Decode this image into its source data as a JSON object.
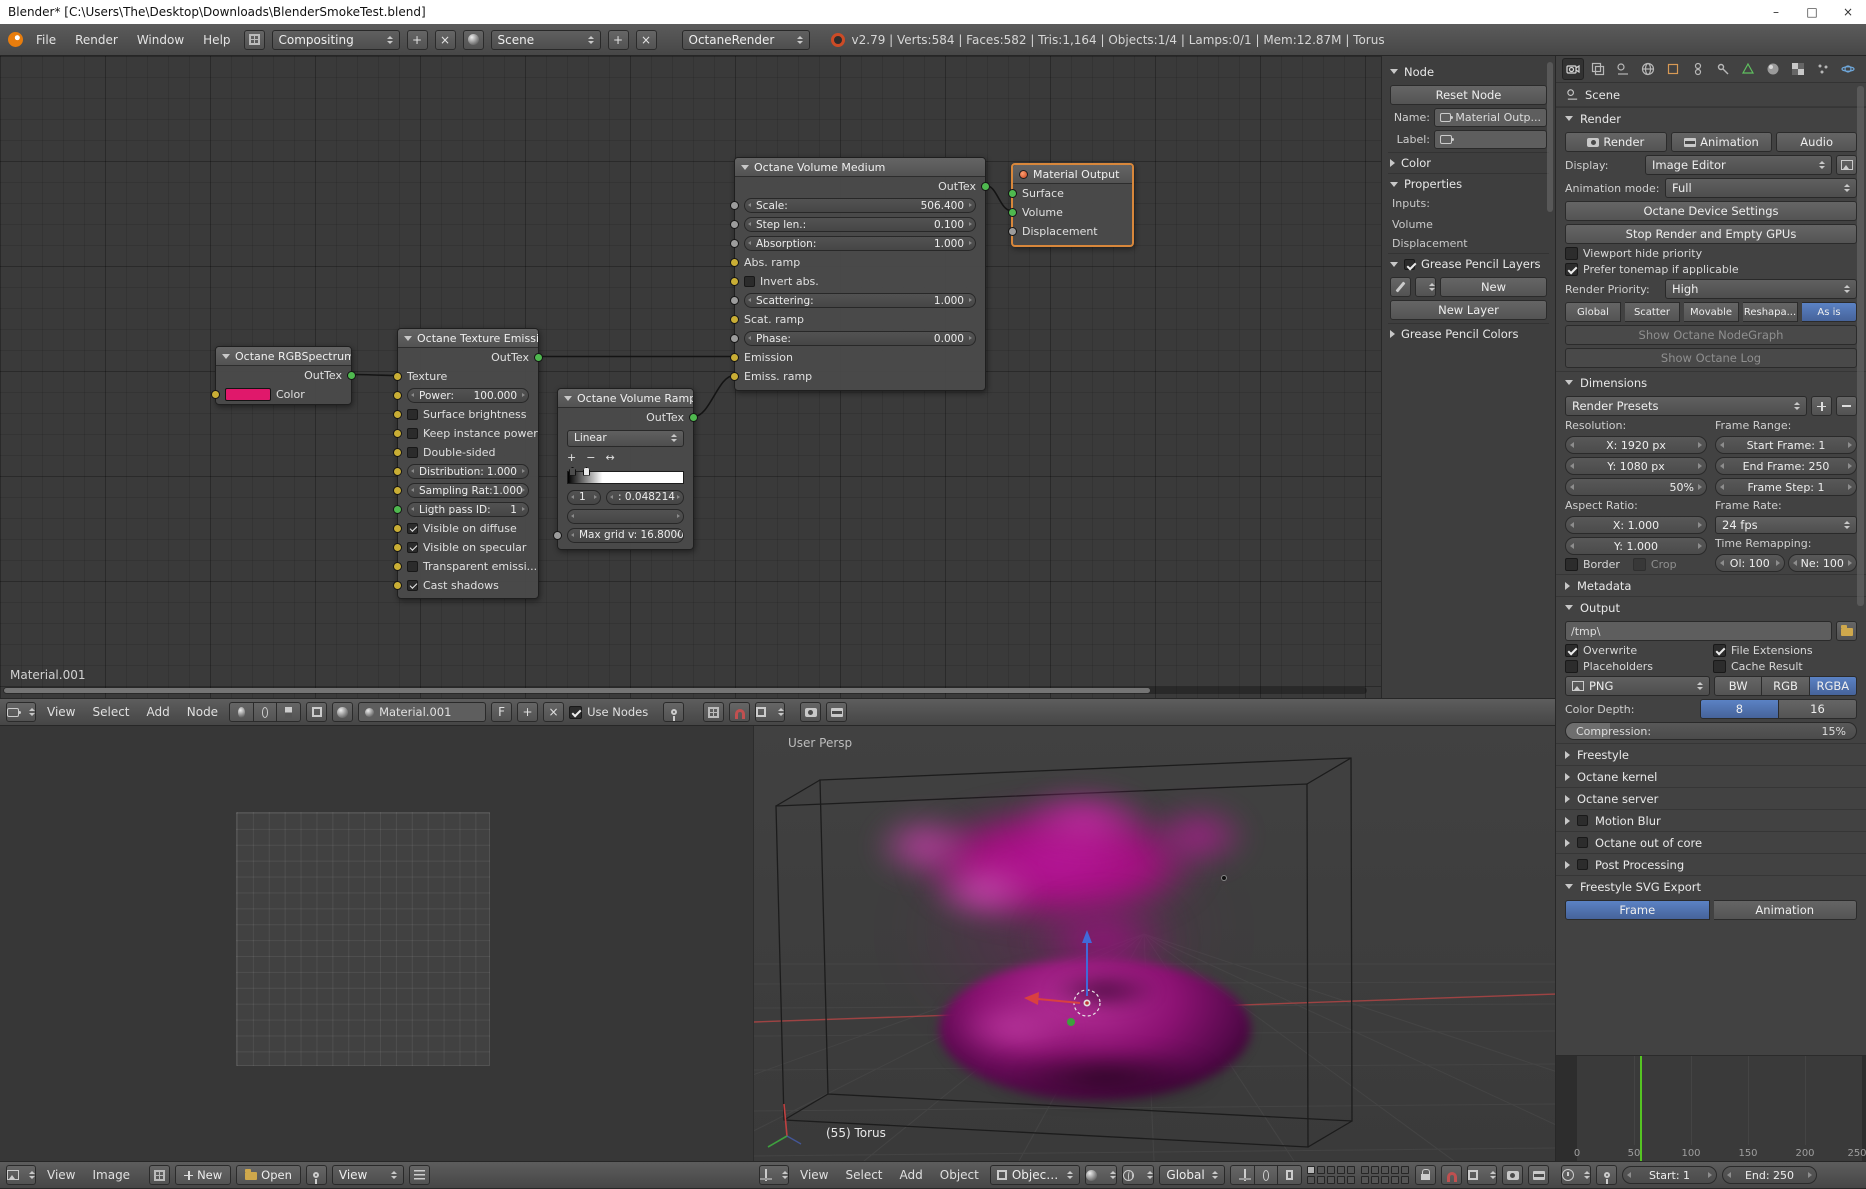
{
  "titlebar": {
    "title": "Blender* [C:\\Users\\The\\Desktop\\Downloads\\BlenderSmokeTest.blend]",
    "minimize": "–",
    "maximize": "□",
    "close": "×"
  },
  "topbar": {
    "menus": [
      "File",
      "Render",
      "Window",
      "Help"
    ],
    "layout": "Compositing",
    "layout_add": "+",
    "layout_close": "×",
    "scene": "Scene",
    "scene_add": "+",
    "scene_close": "×",
    "engine": "OctaneRender",
    "stats": "v2.79 | Verts:584 | Faces:582 | Tris:1,164 | Objects:1/4 | Lamps:0/1 | Mem:12.87M | Torus"
  },
  "node_editor": {
    "material_label": "Material.001"
  },
  "nodes": {
    "rgb": {
      "title": "Octane RGBSpectrum ...",
      "out": "OutTex",
      "color": "Color",
      "swatch": "#e0186b"
    },
    "emission": {
      "title": "Octane Texture Emissi...",
      "out": "OutTex",
      "texture": "Texture",
      "rows": [
        {
          "label": "Power:",
          "value": "100.000"
        },
        {
          "label": "Surface brightness",
          "checked": false
        },
        {
          "label": "Keep instance power",
          "checked": false
        },
        {
          "label": "Double-sided",
          "checked": false
        },
        {
          "label": "Distribution:",
          "value": "1.000"
        },
        {
          "label": "Sampling Rat:",
          "value": "1.000"
        },
        {
          "label": "Ligth pass ID:",
          "value": "1"
        },
        {
          "label": "Visible on diffuse",
          "checked": true
        },
        {
          "label": "Visible on specular",
          "checked": true
        },
        {
          "label": "Transparent emissi...",
          "checked": false
        },
        {
          "label": "Cast shadows",
          "checked": true
        }
      ]
    },
    "ramp": {
      "title": "Octane Volume Ramp ...",
      "out": "OutTex",
      "interpolation": "Linear",
      "add": "+",
      "remove": "−",
      "flip": "↔",
      "index": "1",
      "position": ": 0.048214",
      "max_grid": "Max grid v: 16.8000"
    },
    "medium": {
      "title": "Octane Volume Medium",
      "out": "OutTex",
      "rows": [
        {
          "label": "Scale:",
          "value": "506.400"
        },
        {
          "label": "Step len.:",
          "value": "0.100"
        },
        {
          "label": "Absorption:",
          "value": "1.000"
        },
        {
          "label": "Abs. ramp"
        },
        {
          "label": "Invert abs.",
          "checked": false
        },
        {
          "label": "Scattering:",
          "value": "1.000"
        },
        {
          "label": "Scat. ramp"
        },
        {
          "label": "Phase:",
          "value": "0.000"
        },
        {
          "label": "Emission"
        },
        {
          "label": "Emiss. ramp"
        }
      ]
    },
    "output": {
      "title": "Material Output",
      "rows": [
        "Surface",
        "Volume",
        "Displacement"
      ]
    }
  },
  "node_sidebar": {
    "panel_node": "Node",
    "reset": "Reset Node",
    "name_label": "Name:",
    "name_value": "Material Outp...",
    "label_label": "Label:",
    "panel_color": "Color",
    "panel_props": "Properties",
    "inputs": "Inputs:",
    "in_volume": "Volume",
    "in_displacement": "Displacement",
    "panel_gp": "Grease Pencil Layers",
    "new": "New",
    "new_layer": "New Layer",
    "panel_gp_colors": "Grease Pencil Colors"
  },
  "node_footer": {
    "menus": [
      "View",
      "Select",
      "Add",
      "Node"
    ],
    "name": "Material.001",
    "fake_user": "F",
    "new": "+",
    "unlink": "×",
    "use_nodes": "Use Nodes"
  },
  "props": {
    "breadcrumb": "Scene",
    "panel_render": "Render",
    "btn_render": "Render",
    "btn_animation": "Animation",
    "btn_audio": "Audio",
    "display_label": "Display:",
    "display_value": "Image Editor",
    "anim_mode_label": "Animation mode:",
    "anim_mode_value": "Full",
    "btn_device": "Octane Device Settings",
    "btn_stop": "Stop Render and Empty GPUs",
    "cb_viewport_hide": "Viewport hide priority",
    "cb_prefer_tonemap": "Prefer tonemap if applicable",
    "priority_label": "Render Priority:",
    "priority_value": "High",
    "modes": [
      "Global",
      "Scatter",
      "Movable",
      "Reshapa...",
      "As is"
    ],
    "btn_nodegraph": "Show Octane NodeGraph",
    "btn_log": "Show Octane Log",
    "panel_dimensions": "Dimensions",
    "presets": "Render Presets",
    "resolution_label": "Resolution:",
    "res_x": "X: 1920 px",
    "res_y": "Y: 1080 px",
    "res_pct": "50%",
    "aspect_label": "Aspect Ratio:",
    "aspect_x": "X: 1.000",
    "aspect_y": "Y: 1.000",
    "cb_border": "Border",
    "cb_crop": "Crop",
    "frame_range_label": "Frame Range:",
    "start_frame": "Start Frame: 1",
    "end_frame": "End Frame: 250",
    "frame_step": "Frame Step: 1",
    "frame_rate_label": "Frame Rate:",
    "fps": "24 fps",
    "time_remap_label": "Time Remapping:",
    "old_map": "Ol: 100",
    "new_map": "Ne: 100",
    "panel_metadata": "Metadata",
    "panel_output": "Output",
    "path": "/tmp\\",
    "cb_overwrite": "Overwrite",
    "cb_file_ext": "File Extensions",
    "cb_placeholders": "Placeholders",
    "cb_cache": "Cache Result",
    "format": "PNG",
    "fmt_bw": "BW",
    "fmt_rgb": "RGB",
    "fmt_rgba": "RGBA",
    "depth_label": "Color Depth:",
    "d8": "8",
    "d16": "16",
    "comp_label": "Compression:",
    "comp_value": "15%",
    "panel_freestyle": "Freestyle",
    "panel_kernel": "Octane kernel",
    "panel_server": "Octane server",
    "panel_motion": "Motion Blur",
    "panel_outofcore": "Octane out of core",
    "panel_post": "Post Processing",
    "panel_svg": "Freestyle SVG Export",
    "btn_frame": "Frame",
    "btn_anim2": "Animation"
  },
  "timeline": {
    "ticks": [
      "0",
      "50",
      "100",
      "150",
      "200",
      "250"
    ],
    "start": "Start: 1",
    "end": "End: 250"
  },
  "viewport": {
    "persp": "User Persp",
    "object": "(55) Torus",
    "menus": [
      "View",
      "Select",
      "Add",
      "Object"
    ],
    "mode": "Object Mode",
    "orientation": "Global"
  },
  "image_editor": {
    "menus": [
      "View",
      "Image"
    ],
    "new": "New",
    "open": "Open",
    "view": "View"
  },
  "colors": {
    "accent_blue": "#4e74b2",
    "socket_green": "#4fb94f",
    "socket_yellow": "#c9ae35",
    "selected_node": "#d8873b",
    "smoke_magenta": "#b8169a",
    "timeline_green": "#55c522"
  }
}
